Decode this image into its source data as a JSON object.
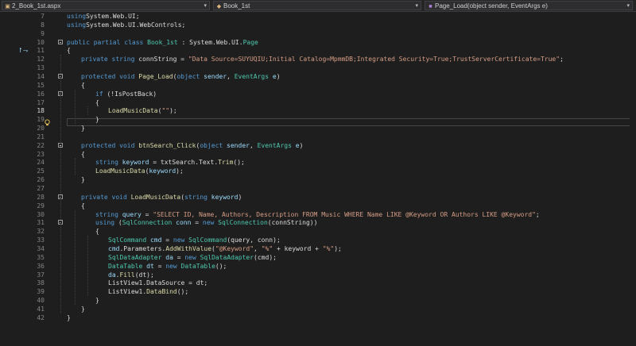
{
  "nav": {
    "file_label": "2_Book_1st.aspx",
    "class_label": "Book_1st",
    "member_label": "Page_Load(object sender, EventArgs e)"
  },
  "colors": {
    "background": "#1e1e1e",
    "keyword": "#569cd6",
    "type": "#4ec9b0",
    "string": "#d69d85",
    "method": "#dcdcaa",
    "line_number": "#858585"
  },
  "icons": {
    "implementation": "implementation-icon",
    "lightbulb": "lightbulb-icon",
    "collapse": "collapse-icon"
  },
  "code_lines": [
    {
      "num": "7",
      "fold": false,
      "tokens": [
        [
          "kw",
          "using"
        ],
        [
          "",
          "System.Web.UI;"
        ]
      ]
    },
    {
      "num": "8",
      "fold": false,
      "tokens": [
        [
          "kw",
          "using"
        ],
        [
          "",
          "System.Web.UI.WebControls;"
        ]
      ]
    },
    {
      "num": "9",
      "fold": false,
      "tokens": []
    },
    {
      "num": "10",
      "fold": true,
      "tokens": [
        [
          "kw",
          "public partial class"
        ],
        [
          "ty",
          " Book_1st"
        ],
        [
          "",
          " : System.Web.UI."
        ],
        [
          "ty",
          "Page"
        ]
      ]
    },
    {
      "num": "11",
      "fold": false,
      "tokens": [
        [
          "",
          "{"
        ]
      ]
    },
    {
      "num": "12",
      "fold": false,
      "tokens": [
        [
          "kw",
          "private string"
        ],
        [
          "",
          " connString = "
        ],
        [
          "st",
          "\"Data Source=SUYUQIU;Initial Catalog=MpmmDB;Integrated Security=True;TrustServerCertificate=True\""
        ],
        [
          "",
          ";"
        ]
      ]
    },
    {
      "num": "13",
      "fold": false,
      "tokens": []
    },
    {
      "num": "14",
      "fold": true,
      "tokens": [
        [
          "kw",
          "protected void"
        ],
        [
          "mt",
          " Page_Load"
        ],
        [
          "",
          "("
        ],
        [
          "kw",
          "object"
        ],
        [
          "pm",
          " sender"
        ],
        [
          "",
          ", "
        ],
        [
          "ty",
          "EventArgs"
        ],
        [
          "pm",
          " e"
        ],
        [
          "",
          ")"
        ]
      ]
    },
    {
      "num": "15",
      "fold": false,
      "tokens": [
        [
          "",
          "{"
        ]
      ]
    },
    {
      "num": "16",
      "fold": true,
      "tokens": [
        [
          "kw",
          "if"
        ],
        [
          "",
          " (!IsPostBack)"
        ]
      ]
    },
    {
      "num": "17",
      "fold": false,
      "tokens": [
        [
          "",
          "{"
        ]
      ]
    },
    {
      "num": "18",
      "fold": false,
      "tokens": [
        [
          "mt",
          "LoadMusicData"
        ],
        [
          "",
          "("
        ],
        [
          "st",
          "\"\""
        ],
        [
          "",
          ");"
        ]
      ]
    },
    {
      "num": "19",
      "fold": false,
      "tokens": [
        [
          "",
          "}"
        ]
      ]
    },
    {
      "num": "20",
      "fold": false,
      "tokens": [
        [
          "",
          "}"
        ]
      ]
    },
    {
      "num": "21",
      "fold": false,
      "tokens": []
    },
    {
      "num": "22",
      "fold": true,
      "tokens": [
        [
          "kw",
          "protected void"
        ],
        [
          "mt",
          " btnSearch_Click"
        ],
        [
          "",
          "("
        ],
        [
          "kw",
          "object"
        ],
        [
          "pm",
          " sender"
        ],
        [
          "",
          ", "
        ],
        [
          "ty",
          "EventArgs"
        ],
        [
          "pm",
          " e"
        ],
        [
          "",
          ")"
        ]
      ]
    },
    {
      "num": "23",
      "fold": false,
      "tokens": [
        [
          "",
          "{"
        ]
      ]
    },
    {
      "num": "24",
      "fold": false,
      "tokens": [
        [
          "kw",
          "string"
        ],
        [
          "vr",
          " keyword"
        ],
        [
          "",
          " = txtSearch.Text."
        ],
        [
          "mt",
          "Trim"
        ],
        [
          "",
          "();"
        ]
      ]
    },
    {
      "num": "25",
      "fold": false,
      "tokens": [
        [
          "mt",
          "LoadMusicData"
        ],
        [
          "",
          "("
        ],
        [
          "vr",
          "keyword"
        ],
        [
          "",
          ");"
        ]
      ]
    },
    {
      "num": "26",
      "fold": false,
      "tokens": [
        [
          "",
          "}"
        ]
      ]
    },
    {
      "num": "27",
      "fold": false,
      "tokens": []
    },
    {
      "num": "28",
      "fold": true,
      "tokens": [
        [
          "kw",
          "private void"
        ],
        [
          "mt",
          " LoadMusicData"
        ],
        [
          "",
          "("
        ],
        [
          "kw",
          "string"
        ],
        [
          "pm",
          " keyword"
        ],
        [
          "",
          ")"
        ]
      ]
    },
    {
      "num": "29",
      "fold": false,
      "tokens": [
        [
          "",
          "{"
        ]
      ]
    },
    {
      "num": "30",
      "fold": false,
      "tokens": [
        [
          "kw",
          "string"
        ],
        [
          "vr",
          " query"
        ],
        [
          "",
          " = "
        ],
        [
          "st",
          "\"SELECT ID, Name, Authors, Description FROM Music WHERE Name LIKE @Keyword OR Authors LIKE @Keyword\""
        ],
        [
          "",
          ";"
        ]
      ]
    },
    {
      "num": "31",
      "fold": true,
      "tokens": [
        [
          "kw",
          "using"
        ],
        [
          "",
          " ("
        ],
        [
          "ty",
          "SqlConnection"
        ],
        [
          "vr",
          " conn"
        ],
        [
          "",
          " = "
        ],
        [
          "kw",
          "new"
        ],
        [
          "ty",
          " SqlConnection"
        ],
        [
          "",
          "(connString))"
        ]
      ]
    },
    {
      "num": "32",
      "fold": false,
      "tokens": [
        [
          "",
          "{"
        ]
      ]
    },
    {
      "num": "33",
      "fold": false,
      "tokens": [
        [
          "ty",
          "SqlCommand"
        ],
        [
          "vr",
          " cmd"
        ],
        [
          "",
          " = "
        ],
        [
          "kw",
          "new"
        ],
        [
          "ty",
          " SqlCommand"
        ],
        [
          "",
          "(query, conn);"
        ]
      ]
    },
    {
      "num": "34",
      "fold": false,
      "tokens": [
        [
          "vr",
          "cmd"
        ],
        [
          "",
          ".Parameters."
        ],
        [
          "mt",
          "AddWithValue"
        ],
        [
          "",
          "("
        ],
        [
          "st",
          "\"@Keyword\""
        ],
        [
          "",
          ", "
        ],
        [
          "st",
          "\"%\""
        ],
        [
          "",
          " + keyword + "
        ],
        [
          "st",
          "\"%\""
        ],
        [
          "",
          ");"
        ]
      ]
    },
    {
      "num": "35",
      "fold": false,
      "tokens": [
        [
          "ty",
          "SqlDataAdapter"
        ],
        [
          "vr",
          " da"
        ],
        [
          "",
          " = "
        ],
        [
          "kw",
          "new"
        ],
        [
          "ty",
          " SqlDataAdapter"
        ],
        [
          "",
          "(cmd);"
        ]
      ]
    },
    {
      "num": "36",
      "fold": false,
      "tokens": [
        [
          "ty",
          "DataTable"
        ],
        [
          "vr",
          " dt"
        ],
        [
          "",
          " = "
        ],
        [
          "kw",
          "new"
        ],
        [
          "ty",
          " DataTable"
        ],
        [
          "",
          "();"
        ]
      ]
    },
    {
      "num": "37",
      "fold": false,
      "tokens": [
        [
          "vr",
          "da"
        ],
        [
          "",
          "."
        ],
        [
          "mt",
          "Fill"
        ],
        [
          "",
          "(dt);"
        ]
      ]
    },
    {
      "num": "38",
      "fold": false,
      "tokens": [
        [
          "",
          "ListView1.DataSource = dt;"
        ]
      ]
    },
    {
      "num": "39",
      "fold": false,
      "tokens": [
        [
          "",
          "ListView1."
        ],
        [
          "mt",
          "DataBind"
        ],
        [
          "",
          "();"
        ]
      ]
    },
    {
      "num": "40",
      "fold": false,
      "tokens": [
        [
          "",
          "}"
        ]
      ]
    },
    {
      "num": "41",
      "fold": false,
      "tokens": [
        [
          "",
          "}"
        ]
      ]
    },
    {
      "num": "42",
      "fold": false,
      "tokens": [
        [
          "",
          "}"
        ]
      ]
    }
  ]
}
